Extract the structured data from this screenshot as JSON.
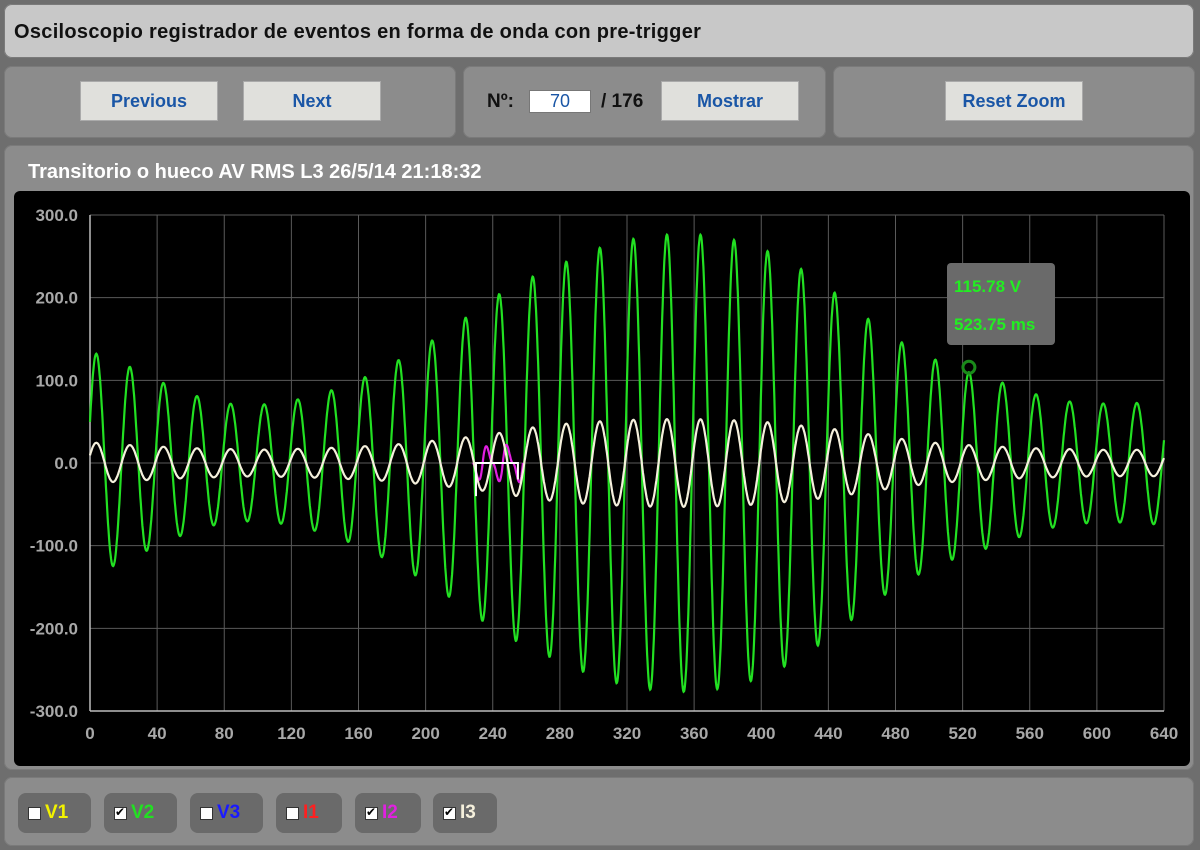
{
  "header": {
    "title": "Osciloscopio registrador de eventos en forma de onda con pre-trigger"
  },
  "nav": {
    "previous_label": "Previous",
    "next_label": "Next"
  },
  "record": {
    "number_label": "Nº:",
    "current": "70",
    "total_label": "/ 176",
    "show_label": "Mostrar"
  },
  "zoom": {
    "reset_label": "Reset Zoom"
  },
  "chart_title": "Transitorio o hueco AV RMS L3 26/5/14 21:18:32",
  "tooltip": {
    "value": "115.78 V",
    "time": "523.75 ms"
  },
  "channels": [
    {
      "label": "V1",
      "checked": false,
      "color": "#f2f200"
    },
    {
      "label": "V2",
      "checked": true,
      "color": "#22e022"
    },
    {
      "label": "V3",
      "checked": false,
      "color": "#1a1aff"
    },
    {
      "label": "I1",
      "checked": false,
      "color": "#ff2020"
    },
    {
      "label": "I2",
      "checked": true,
      "color": "#e020e0"
    },
    {
      "label": "I3",
      "checked": true,
      "color": "#f5f0dc"
    }
  ],
  "chart_data": {
    "type": "line",
    "xlabel": "",
    "ylabel": "",
    "xlim": [
      0,
      640
    ],
    "ylim": [
      -300,
      300
    ],
    "x_ticks": [
      "0",
      "40",
      "80",
      "120",
      "160",
      "200",
      "240",
      "280",
      "320",
      "360",
      "400",
      "440",
      "480",
      "520",
      "560",
      "600",
      "640"
    ],
    "y_ticks": [
      "300.0",
      "200.0",
      "100.0",
      "0.0",
      "-100.0",
      "-200.0",
      "-300.0"
    ],
    "grid": true,
    "period_ms": 20,
    "highlight_point": {
      "x": 523.75,
      "y": 115.78
    },
    "series": [
      {
        "name": "V2",
        "color": "#22e022",
        "x": [
          0,
          20,
          40,
          60,
          80,
          100,
          120,
          140,
          160,
          180,
          200,
          220,
          240,
          260,
          280,
          300,
          320,
          340,
          360,
          380,
          400,
          420,
          440,
          460,
          480,
          500,
          520,
          540,
          560,
          580,
          600,
          620,
          640
        ],
        "amplitude": [
          135,
          120,
          100,
          83,
          72,
          70,
          75,
          85,
          100,
          120,
          143,
          170,
          200,
          222,
          240,
          258,
          270,
          276,
          277,
          272,
          260,
          240,
          212,
          180,
          150,
          128,
          112,
          100,
          85,
          75,
          72,
          72,
          75
        ]
      },
      {
        "name": "I3",
        "color": "#f5f0dc",
        "x": [
          0,
          20,
          40,
          60,
          80,
          100,
          120,
          140,
          160,
          180,
          200,
          220,
          240,
          260,
          280,
          300,
          320,
          340,
          360,
          380,
          400,
          420,
          440,
          460,
          480,
          500,
          520,
          540,
          560,
          580,
          600,
          620,
          640
        ],
        "amplitude": [
          25,
          22,
          20,
          18,
          17,
          16,
          17,
          18,
          20,
          22,
          26,
          30,
          35,
          42,
          47,
          50,
          52,
          53,
          53,
          52,
          50,
          46,
          42,
          36,
          30,
          25,
          22,
          20,
          18,
          17,
          16,
          16,
          16
        ]
      },
      {
        "name": "I2",
        "color": "#e020e0",
        "x": [
          228,
          234,
          240,
          246,
          252,
          258
        ],
        "y": [
          0,
          -35,
          0,
          38,
          0,
          -40
        ]
      }
    ]
  }
}
